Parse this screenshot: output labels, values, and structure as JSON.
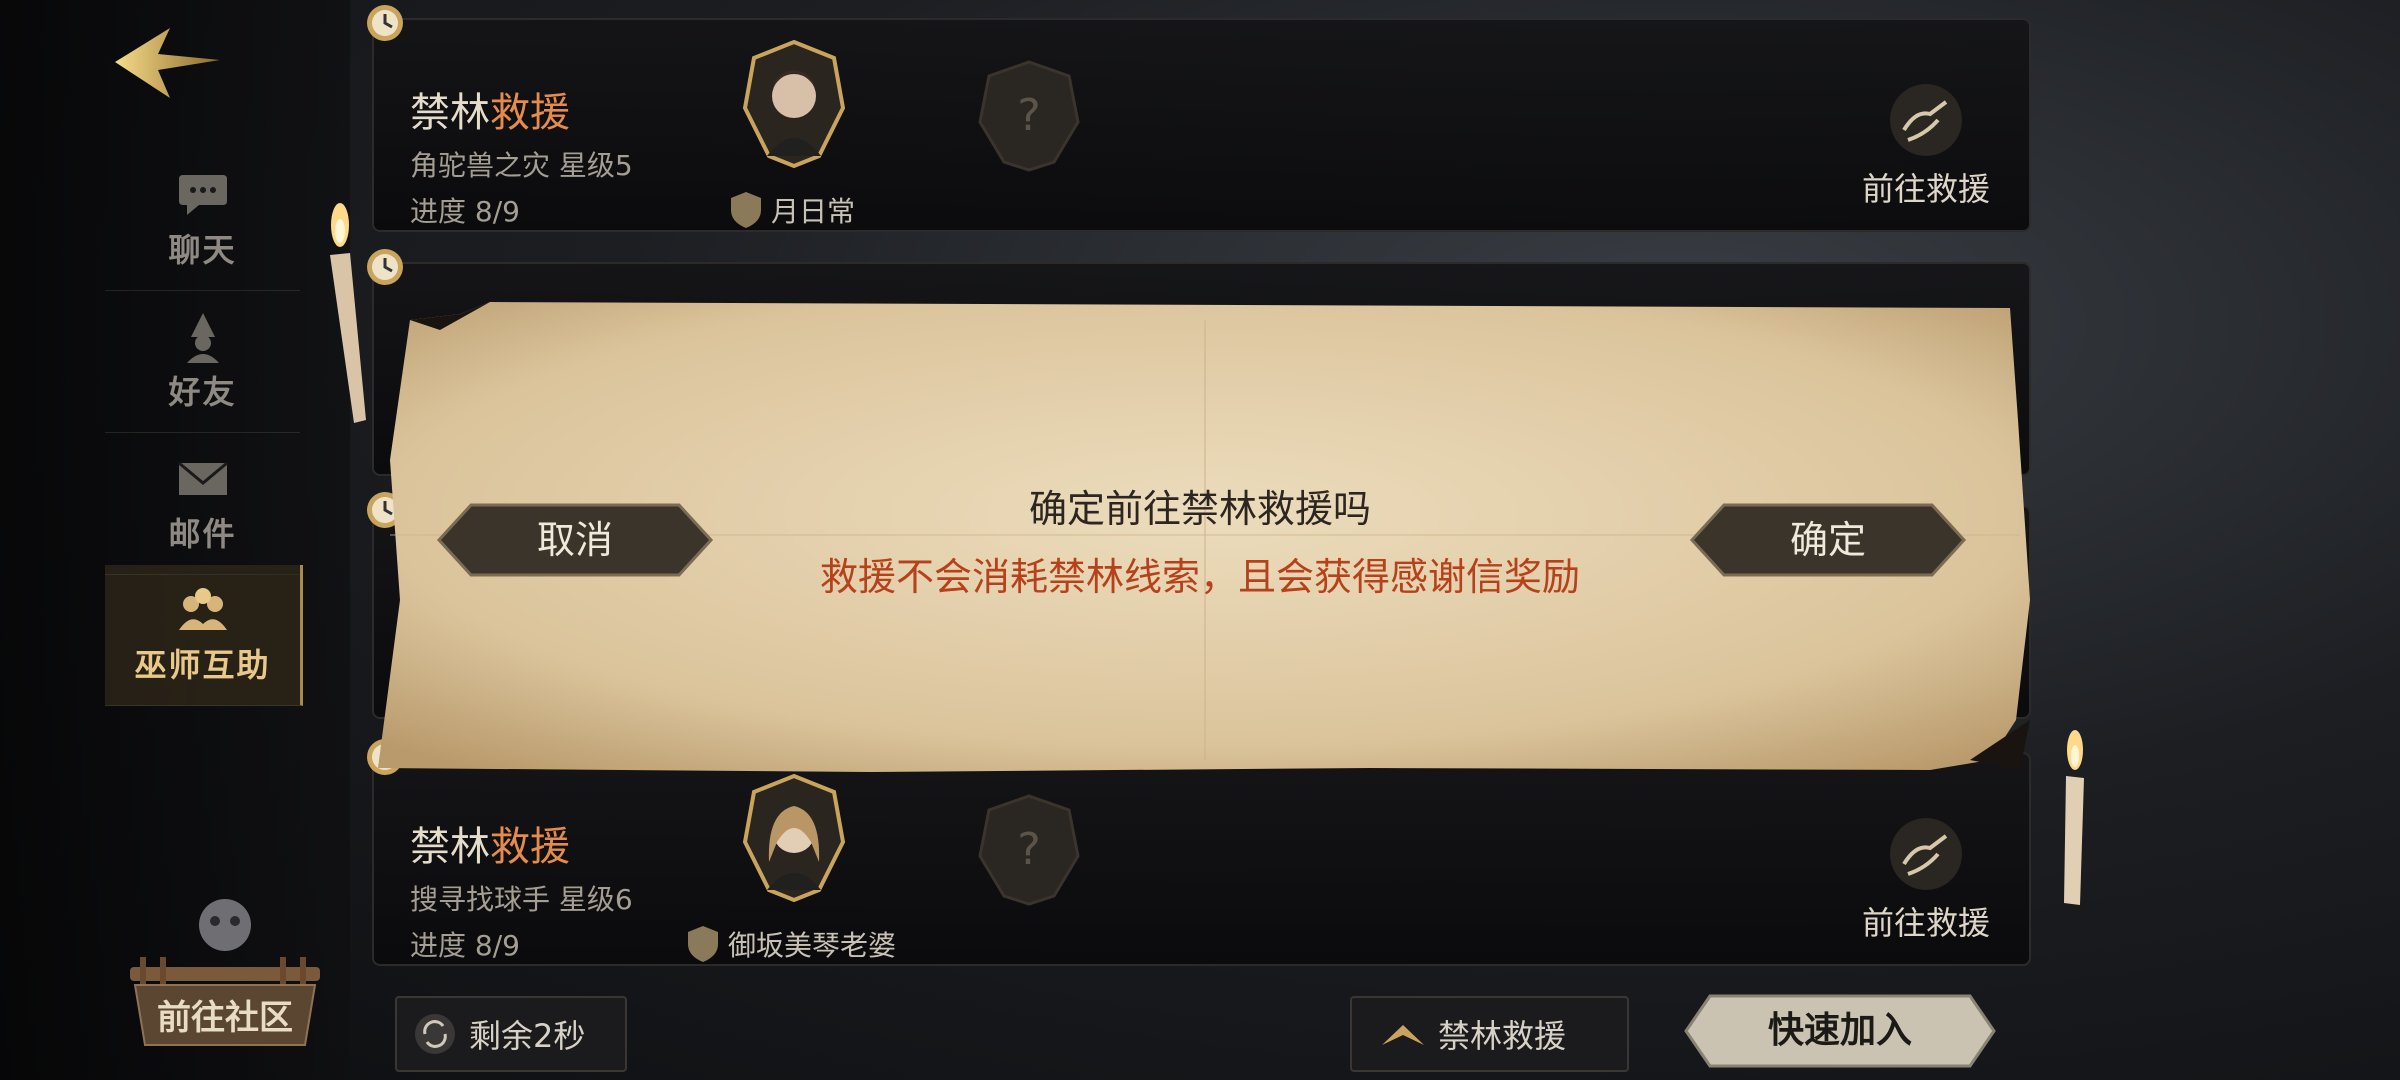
{
  "sidebar": {
    "items": [
      {
        "label": "聊天",
        "icon": "chat-icon"
      },
      {
        "label": "好友",
        "icon": "friend-wizard-icon"
      },
      {
        "label": "邮件",
        "icon": "mail-icon"
      },
      {
        "label": "巫师互助",
        "icon": "wizard-help-icon"
      }
    ],
    "community_label": "前往社区"
  },
  "cards": [
    {
      "title_a": "禁林",
      "title_b": "救援",
      "sub": "角驼兽之灾 星级5",
      "progress": "进度 8/9",
      "owner": "月日常",
      "goto": "前往救援"
    },
    {
      "title_a": "禁林",
      "title_b": "救援",
      "sub": "搜寻找球手 星级6",
      "progress": "进度 8/9",
      "owner": "御坂美琴老婆",
      "goto": "前往救援"
    }
  ],
  "bottom": {
    "timer": "剩余2秒",
    "filter": "禁林救援",
    "join": "快速加入"
  },
  "dialog": {
    "title": "确定前往禁林救援吗",
    "note": "救援不会消耗禁林线索，且会获得感谢信奖励",
    "cancel": "取消",
    "confirm": "确定"
  },
  "colors": {
    "accent": "#e58c4c",
    "warning_text": "#b6411a",
    "parchment": "#e4d3b2",
    "gold": "#c9a45c"
  }
}
